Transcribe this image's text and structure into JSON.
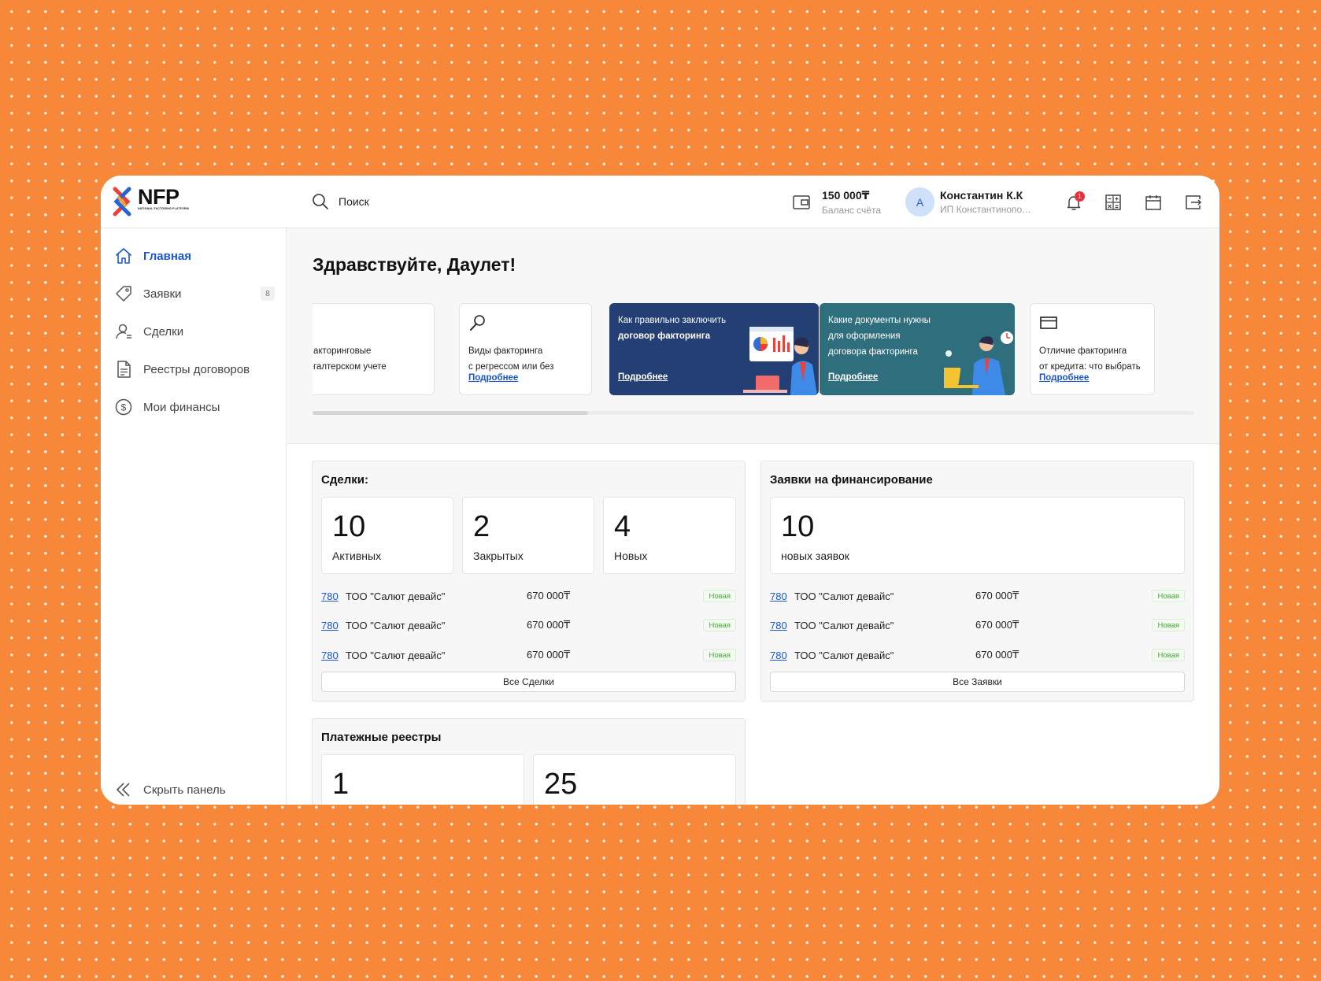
{
  "header": {
    "logo_title": "NFP",
    "logo_sub": "NATIONAL FACTORING PLATFORM",
    "search_label": "Поиск",
    "balance_value": "150 000₸",
    "balance_label": "Баланс счёта",
    "avatar_letter": "А",
    "user_name": "Константин К.К",
    "user_org": "ИП Константинопольский",
    "notification_count": "1"
  },
  "sidebar": {
    "items": [
      {
        "label": "Главная",
        "icon": "home-icon",
        "active": true
      },
      {
        "label": "Заявки",
        "icon": "tag-icon",
        "badge": "8"
      },
      {
        "label": "Сделки",
        "icon": "user-deal-icon"
      },
      {
        "label": "Реестры договоров",
        "icon": "document-icon"
      },
      {
        "label": "Мои финансы",
        "icon": "dollar-icon"
      }
    ],
    "collapse_label": "Скрыть панель"
  },
  "greeting": "Здравствуйте, Даулет!",
  "cards": [
    {
      "line1": "акторинговые",
      "line2": "галтерском учете"
    },
    {
      "line1": "Виды факторинга",
      "line2": "с регрессом или без",
      "link": "Подробнее"
    },
    {
      "line1": "Как правильно заключить",
      "line2": "договор факторинга",
      "link": "Подробнее"
    },
    {
      "line1": "Какие документы нужны",
      "line2": "для оформления",
      "line3": "договора факторинга",
      "link": "Подробнее"
    },
    {
      "line1": "Отличие факторинга",
      "line2": "от кредита: что выбрать",
      "link": "Подробнее"
    }
  ],
  "deals": {
    "title": "Сделки:",
    "stats": [
      {
        "value": "10",
        "label": "Активных"
      },
      {
        "value": "2",
        "label": "Закрытых"
      },
      {
        "value": "4",
        "label": "Новых"
      }
    ],
    "rows": [
      {
        "id": "780",
        "name": "ТОО \"Салют девайс\"",
        "amount": "670 000₸",
        "status": "Новая"
      },
      {
        "id": "780",
        "name": "ТОО \"Салют девайс\"",
        "amount": "670 000₸",
        "status": "Новая"
      },
      {
        "id": "780",
        "name": "ТОО \"Салют девайс\"",
        "amount": "670 000₸",
        "status": "Новая"
      }
    ],
    "all_label": "Все Сделки"
  },
  "requests": {
    "title": "Заявки на финансирование",
    "stat": {
      "value": "10",
      "label": "новых заявок"
    },
    "rows": [
      {
        "id": "780",
        "name": "ТОО \"Салют девайс\"",
        "amount": "670 000₸",
        "status": "Новая"
      },
      {
        "id": "780",
        "name": "ТОО \"Салют девайс\"",
        "amount": "670 000₸",
        "status": "Новая"
      },
      {
        "id": "780",
        "name": "ТОО \"Салют девайс\"",
        "amount": "670 000₸",
        "status": "Новая"
      }
    ],
    "all_label": "Все Заявки"
  },
  "registries": {
    "title": "Платежные реестры",
    "stats": [
      {
        "value": "1"
      },
      {
        "value": "25"
      }
    ]
  },
  "colors": {
    "background": "#f7883a",
    "accent": "#1a56d4",
    "card_navy": "#243f73",
    "card_teal": "#2f6e7c",
    "status_green": "#49a83b"
  }
}
